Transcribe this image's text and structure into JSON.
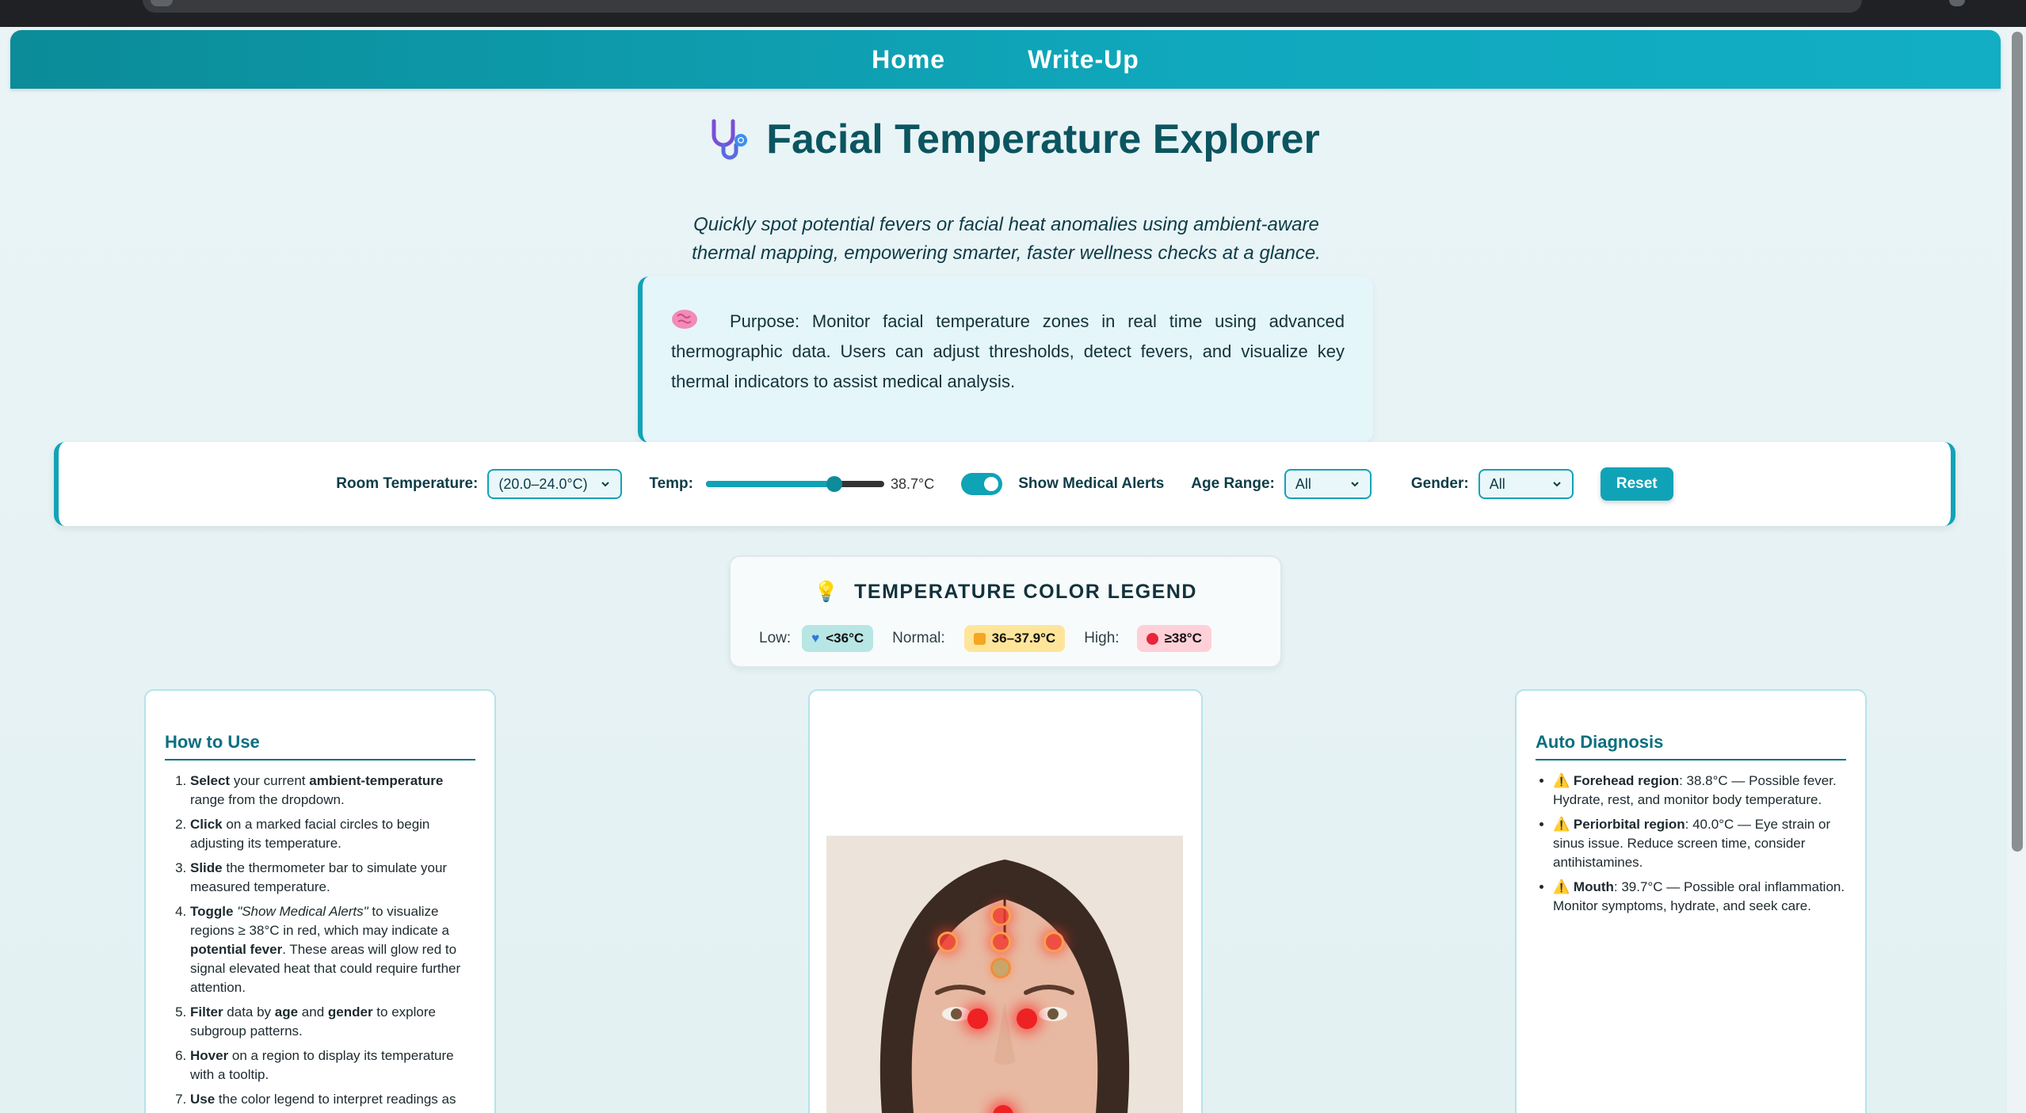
{
  "nav": {
    "home": "Home",
    "writeup": "Write-Up"
  },
  "header": {
    "title": "Facial Temperature Explorer",
    "subtitle": "Quickly spot potential fevers or facial heat anomalies using ambient-aware thermal mapping, empowering smarter, faster wellness checks at a glance."
  },
  "purpose": {
    "text": "Purpose: Monitor facial temperature zones in real time using advanced thermographic data. Users can adjust thresholds, detect fevers, and visualize key thermal indicators to assist medical analysis."
  },
  "controls": {
    "room_label": "Room Temperature:",
    "room_value": "(20.0–24.0°C)",
    "temp_label": "Temp:",
    "temp_value": "38.7°C",
    "temp_fraction": 0.72,
    "alerts_label": "Show Medical Alerts",
    "alerts_on": true,
    "age_label": "Age Range:",
    "age_value": "All",
    "gender_label": "Gender:",
    "gender_value": "All",
    "reset": "Reset"
  },
  "legend": {
    "title": "TEMPERATURE COLOR LEGEND",
    "low_label": "Low:",
    "low_value": "<36°C",
    "normal_label": "Normal:",
    "normal_value": "36–37.9°C",
    "high_label": "High:",
    "high_value": "≥38°C",
    "low_color": "#b7e6e4",
    "normal_color": "#ffe59a",
    "high_color": "#ffd0d8"
  },
  "how_to": {
    "title": "How to Use",
    "steps": [
      {
        "b1": "Select",
        "t1": " your current ",
        "b2": "ambient-temperature",
        "t2": " range from the dropdown."
      },
      {
        "b1": "Click",
        "t1": " on a marked facial circles to begin adjusting its temperature.",
        "b2": "",
        "t2": ""
      },
      {
        "b1": "Slide",
        "t1": " the thermometer bar to simulate your measured temperature.",
        "b2": "",
        "t2": ""
      },
      {
        "b1": "Toggle",
        "i1": "\"Show Medical Alerts\"",
        "t1": " to visualize regions ≥ 38°C in red, which may indicate a ",
        "b2": "potential fever",
        "t2": ". These areas will glow red to signal elevated heat that could require further attention."
      },
      {
        "b1": "Filter",
        "t1": " data by ",
        "b2": "age",
        "t2": " and ",
        "b3": "gender",
        "t3": " to explore subgroup patterns."
      },
      {
        "b1": "Hover",
        "t1": " on a region to display its temperature with a tooltip.",
        "b2": "",
        "t2": ""
      },
      {
        "b1": "Use",
        "t1": " the color legend to interpret readings as",
        "b2": "",
        "t2": ""
      }
    ]
  },
  "diagnosis": {
    "title": "Auto Diagnosis",
    "items": [
      {
        "region": "Forehead region",
        "text": ": 38.8°C — Possible fever. Hydrate, rest, and monitor body temperature."
      },
      {
        "region": "Periorbital region",
        "text": ": 40.0°C — Eye strain or sinus issue. Reduce screen time, consider antihistamines."
      },
      {
        "region": "Mouth",
        "text": ": 39.7°C — Possible oral inflammation. Monitor symptoms, hydrate, and seek care."
      }
    ]
  }
}
